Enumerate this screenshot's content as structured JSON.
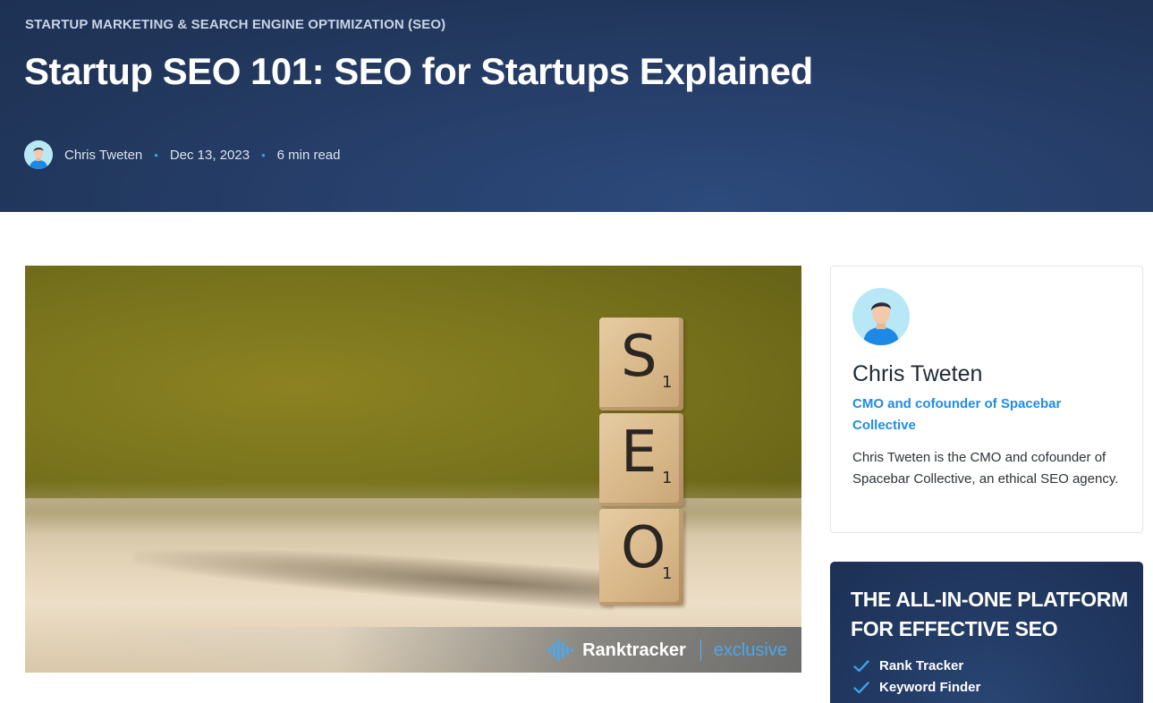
{
  "header": {
    "category": "STARTUP MARKETING & SEARCH ENGINE OPTIMIZATION (SEO)",
    "title": "Startup SEO 101: SEO for Startups Explained",
    "author": "Chris Tweten",
    "date": "Dec 13, 2023",
    "read_time": "6 min read",
    "separator": "•"
  },
  "featured_image": {
    "tiles": [
      {
        "letter": "S",
        "value": "1"
      },
      {
        "letter": "E",
        "value": "1"
      },
      {
        "letter": "O",
        "value": "1"
      }
    ],
    "badge_brand": "Ranktracker",
    "badge_tag": "exclusive"
  },
  "author_card": {
    "name": "Chris Tweten",
    "role": "CMO and cofounder of Spacebar Collective",
    "bio": "Chris Tweten is the CMO and cofounder of Spacebar Collective, an ethical SEO agency."
  },
  "promo": {
    "title": "THE ALL-IN-ONE PLATFORM FOR EFFECTIVE SEO",
    "features": [
      "Rank Tracker",
      "Keyword Finder"
    ]
  },
  "icons": {
    "avatar": "user-avatar-icon",
    "badge_logo": "ranktracker-logo-icon",
    "check": "check-icon"
  },
  "colors": {
    "hero_bg": "#243a62",
    "accent_blue": "#1f8ce6",
    "dot_blue": "#3aa0e8",
    "promo_bg": "#1d3055"
  }
}
